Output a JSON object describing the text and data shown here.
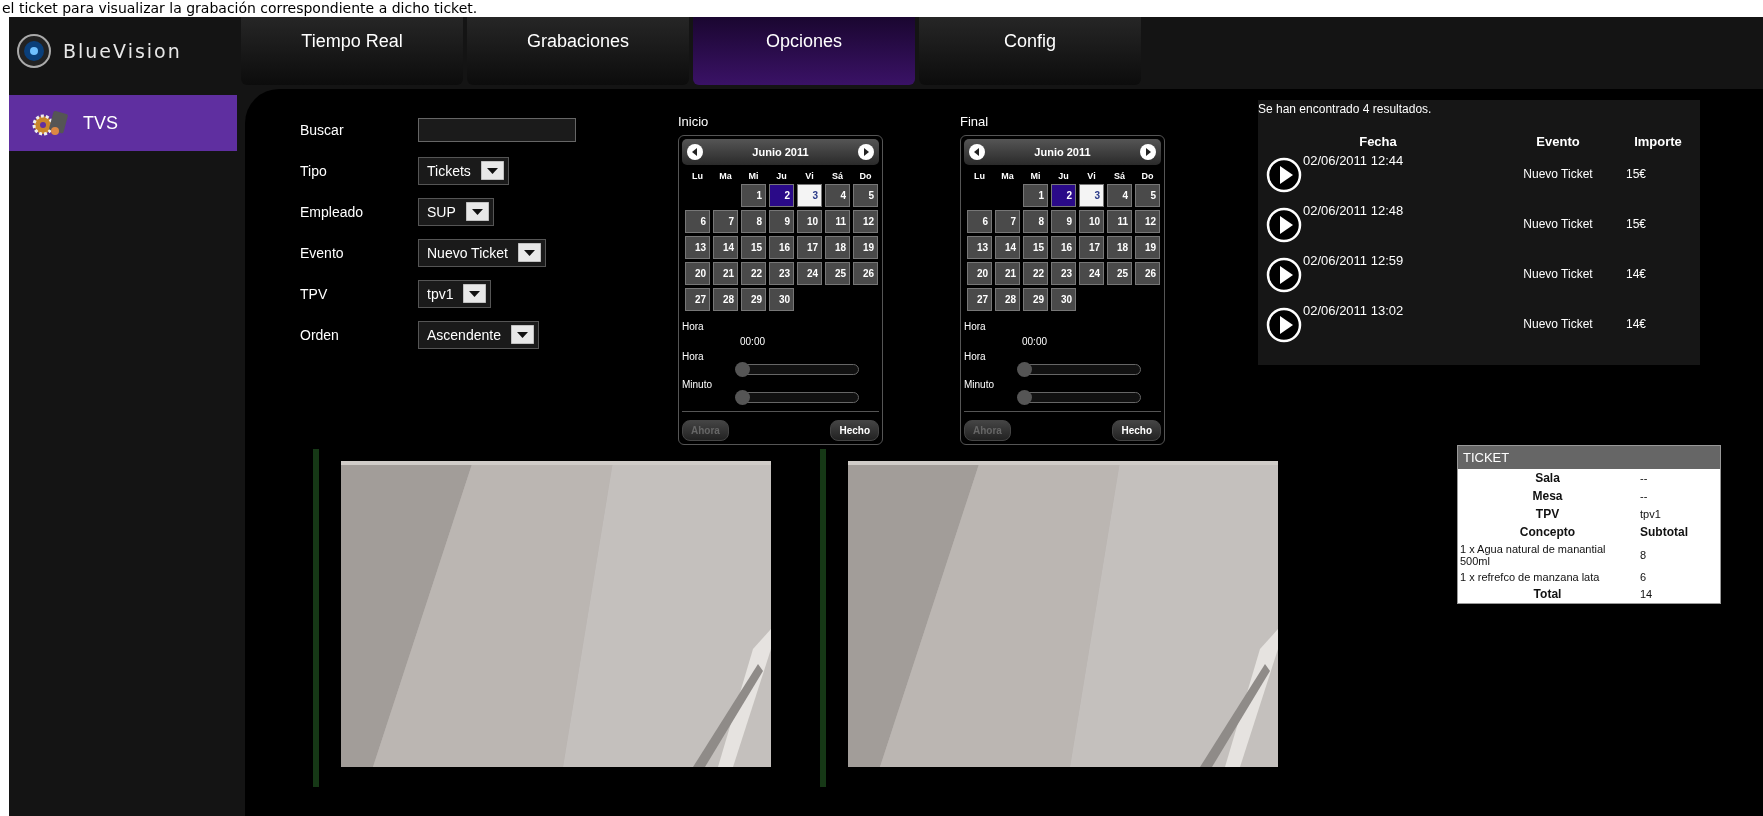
{
  "caption": "el ticket para visualizar la grabación correspondiente a dicho ticket.",
  "logo": {
    "name": "BlueVision"
  },
  "nav": [
    {
      "label": "Tiempo Real",
      "selected": false
    },
    {
      "label": "Grabaciones",
      "selected": false
    },
    {
      "label": "Opciones",
      "selected": true
    },
    {
      "label": "Config",
      "selected": false
    }
  ],
  "sidebar": {
    "items": [
      {
        "label": "TVS",
        "selected": true
      }
    ]
  },
  "filters": [
    {
      "kind": "text",
      "label": "Buscar"
    },
    {
      "kind": "select",
      "label": "Tipo",
      "value": "Tickets"
    },
    {
      "kind": "select",
      "label": "Empleado",
      "value": "SUP"
    },
    {
      "kind": "select",
      "label": "Evento",
      "value": "Nuevo Ticket"
    },
    {
      "kind": "select",
      "label": "TPV",
      "value": "tpv1"
    },
    {
      "kind": "select",
      "label": "Orden",
      "value": "Ascendente"
    }
  ],
  "calendars": [
    {
      "label": "Inicio",
      "month": "Junio 2011",
      "weekdays": [
        "Lu",
        "Ma",
        "Mi",
        "Ju",
        "Vi",
        "Sá",
        "Do"
      ],
      "days": [
        {
          "label": "1",
          "selected": false,
          "today": false
        },
        {
          "label": "2",
          "selected": true,
          "today": false
        },
        {
          "label": "3",
          "selected": false,
          "today": true
        },
        {
          "label": "4",
          "selected": false,
          "today": false
        },
        {
          "label": "5",
          "selected": false,
          "today": false
        },
        {
          "label": "6",
          "selected": false,
          "today": false
        },
        {
          "label": "7",
          "selected": false,
          "today": false
        },
        {
          "label": "8",
          "selected": false,
          "today": false
        },
        {
          "label": "9",
          "selected": false,
          "today": false
        },
        {
          "label": "10",
          "selected": false,
          "today": false
        },
        {
          "label": "11",
          "selected": false,
          "today": false
        },
        {
          "label": "12",
          "selected": false,
          "today": false
        },
        {
          "label": "13",
          "selected": false,
          "today": false
        },
        {
          "label": "14",
          "selected": false,
          "today": false
        },
        {
          "label": "15",
          "selected": false,
          "today": false
        },
        {
          "label": "16",
          "selected": false,
          "today": false
        },
        {
          "label": "17",
          "selected": false,
          "today": false
        },
        {
          "label": "18",
          "selected": false,
          "today": false
        },
        {
          "label": "19",
          "selected": false,
          "today": false
        },
        {
          "label": "20",
          "selected": false,
          "today": false
        },
        {
          "label": "21",
          "selected": false,
          "today": false
        },
        {
          "label": "22",
          "selected": false,
          "today": false
        },
        {
          "label": "23",
          "selected": false,
          "today": false
        },
        {
          "label": "24",
          "selected": false,
          "today": false
        },
        {
          "label": "25",
          "selected": false,
          "today": false
        },
        {
          "label": "26",
          "selected": false,
          "today": false
        },
        {
          "label": "27",
          "selected": false,
          "today": false
        },
        {
          "label": "28",
          "selected": false,
          "today": false
        },
        {
          "label": "29",
          "selected": false,
          "today": false
        },
        {
          "label": "30",
          "selected": false,
          "today": false
        }
      ],
      "time_label": "Hora",
      "time": "00:00",
      "sliders": [
        {
          "label": "Hora",
          "level": 0
        },
        {
          "label": "Minuto",
          "level": 0
        }
      ],
      "buttons": [
        {
          "label": "Ahora",
          "disabled": true
        },
        {
          "label": "Hecho",
          "disabled": false
        }
      ]
    },
    {
      "label": "Final",
      "month": "Junio 2011",
      "weekdays": [
        "Lu",
        "Ma",
        "Mi",
        "Ju",
        "Vi",
        "Sá",
        "Do"
      ],
      "days": [
        {
          "label": "1",
          "selected": false,
          "today": false
        },
        {
          "label": "2",
          "selected": true,
          "today": false
        },
        {
          "label": "3",
          "selected": false,
          "today": true
        },
        {
          "label": "4",
          "selected": false,
          "today": false
        },
        {
          "label": "5",
          "selected": false,
          "today": false
        },
        {
          "label": "6",
          "selected": false,
          "today": false
        },
        {
          "label": "7",
          "selected": false,
          "today": false
        },
        {
          "label": "8",
          "selected": false,
          "today": false
        },
        {
          "label": "9",
          "selected": false,
          "today": false
        },
        {
          "label": "10",
          "selected": false,
          "today": false
        },
        {
          "label": "11",
          "selected": false,
          "today": false
        },
        {
          "label": "12",
          "selected": false,
          "today": false
        },
        {
          "label": "13",
          "selected": false,
          "today": false
        },
        {
          "label": "14",
          "selected": false,
          "today": false
        },
        {
          "label": "15",
          "selected": false,
          "today": false
        },
        {
          "label": "16",
          "selected": false,
          "today": false
        },
        {
          "label": "17",
          "selected": false,
          "today": false
        },
        {
          "label": "18",
          "selected": false,
          "today": false
        },
        {
          "label": "19",
          "selected": false,
          "today": false
        },
        {
          "label": "20",
          "selected": false,
          "today": false
        },
        {
          "label": "21",
          "selected": false,
          "today": false
        },
        {
          "label": "22",
          "selected": false,
          "today": false
        },
        {
          "label": "23",
          "selected": false,
          "today": false
        },
        {
          "label": "24",
          "selected": false,
          "today": false
        },
        {
          "label": "25",
          "selected": false,
          "today": false
        },
        {
          "label": "26",
          "selected": false,
          "today": false
        },
        {
          "label": "27",
          "selected": false,
          "today": false
        },
        {
          "label": "28",
          "selected": false,
          "today": false
        },
        {
          "label": "29",
          "selected": false,
          "today": false
        },
        {
          "label": "30",
          "selected": false,
          "today": false
        }
      ],
      "time_label": "Hora",
      "time": "00:00",
      "sliders": [
        {
          "label": "Hora",
          "level": 0
        },
        {
          "label": "Minuto",
          "level": 0
        }
      ],
      "buttons": [
        {
          "label": "Ahora",
          "disabled": true
        },
        {
          "label": "Hecho",
          "disabled": false
        }
      ]
    }
  ],
  "results": {
    "summary": "Se han encontrado 4 resultados.",
    "columns": [
      "Fecha",
      "Evento",
      "Importe"
    ],
    "rows": [
      {
        "fecha": "02/06/2011 12:44",
        "evento": "Nuevo Ticket",
        "importe": "15€"
      },
      {
        "fecha": "02/06/2011 12:48",
        "evento": "Nuevo Ticket",
        "importe": "15€"
      },
      {
        "fecha": "02/06/2011 12:59",
        "evento": "Nuevo Ticket",
        "importe": "14€"
      },
      {
        "fecha": "02/06/2011 13:02",
        "evento": "Nuevo Ticket",
        "importe": "14€"
      }
    ]
  },
  "ticket": {
    "title": "TICKET",
    "rows": [
      {
        "kind": "field",
        "label": "Sala",
        "value": "--"
      },
      {
        "kind": "field",
        "label": "Mesa",
        "value": "--"
      },
      {
        "kind": "field",
        "label": "TPV",
        "value": "tpv1"
      },
      {
        "kind": "header",
        "label": "Concepto",
        "value": "Subtotal"
      },
      {
        "kind": "item",
        "label": "1 x Agua natural de manantial 500ml",
        "value": "8"
      },
      {
        "kind": "item",
        "label": "1 x refrefco de manzana lata",
        "value": "6"
      },
      {
        "kind": "total",
        "label": "Total",
        "value": "14"
      }
    ]
  }
}
